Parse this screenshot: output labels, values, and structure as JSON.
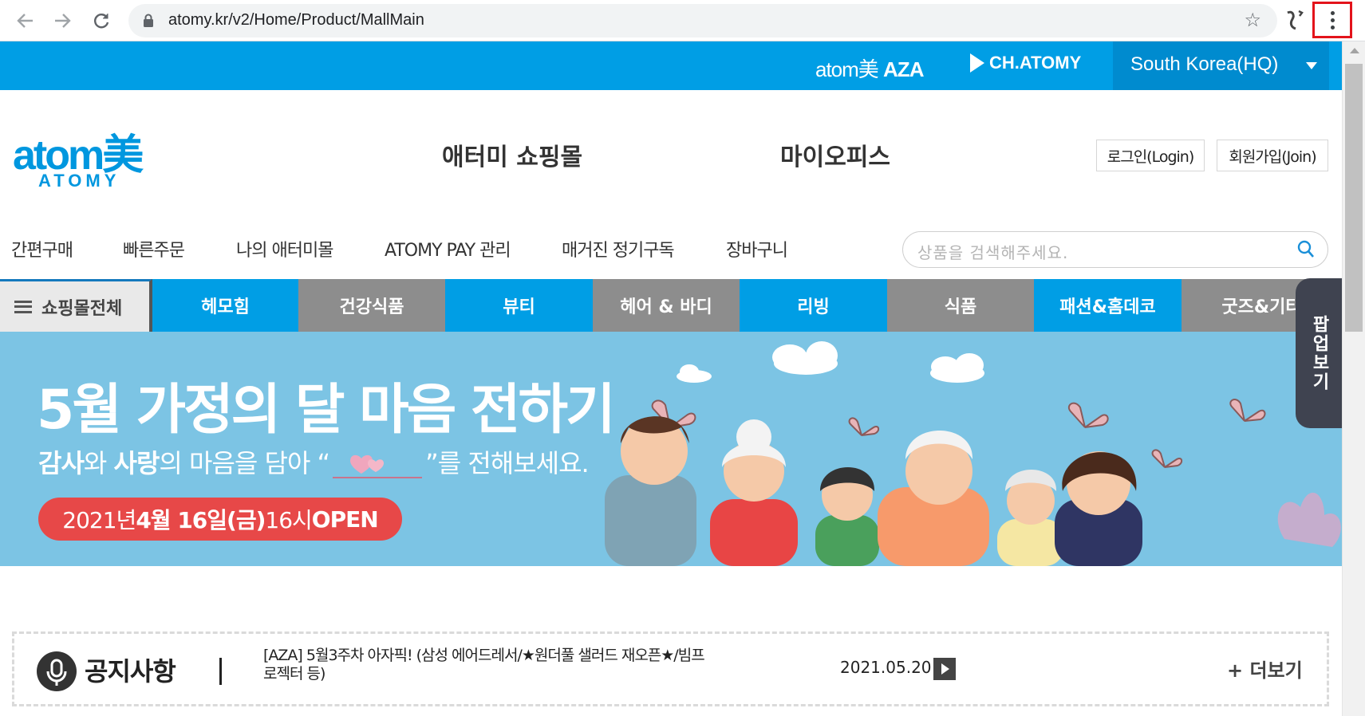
{
  "browser": {
    "url": "atomy.kr/v2/Home/Product/MallMain",
    "back_icon": "arrow-left-icon",
    "forward_icon": "arrow-right-icon",
    "reload_icon": "reload-icon",
    "menu_icon": "kebab-menu-icon"
  },
  "topbar": {
    "aza_light": "atom美 ",
    "aza_bold": "AZA",
    "ch_atomy": "CH.ATOMY",
    "region": "South Korea(HQ)",
    "accent": "#009ee5"
  },
  "header": {
    "logo_word": "atom美",
    "logo_sub": "ATOMY",
    "shopping_mall": "애터미 쇼핑몰",
    "my_office": "마이오피스",
    "login": "로그인(Login)",
    "join": "회원가입(Join)"
  },
  "subnav": {
    "items": [
      "간편구매",
      "빠른주문",
      "나의 애터미몰",
      "ATOMY PAY 관리",
      "매거진 정기구독",
      "장바구니"
    ],
    "search_placeholder": "상품을 검색해주세요."
  },
  "categories": {
    "all": "쇼핑몰전체",
    "items": [
      "헤모힘",
      "건강식품",
      "뷰티",
      "헤어 & 바디",
      "리빙",
      "식품",
      "패션&홈데코",
      "굿즈&기타"
    ]
  },
  "popup_tab": "팝업보기",
  "banner": {
    "title": "5월 가정의 달 마음 전하기",
    "sub_b1": "감사",
    "sub_1": "와 ",
    "sub_b2": "사랑",
    "sub_2": "의 마음을 담아 “",
    "sub_3": "”를 전해보세요.",
    "open_1": "2021년 ",
    "open_b1": "4월 16일(금)",
    "open_2": " 16시 ",
    "open_b2": "OPEN"
  },
  "notice": {
    "title": "공지사항",
    "headline": "[AZA] 5월3주차 아자픽! (삼성 에어드레서/★원더풀 샐러드 재오픈★/빔프로젝터 등)",
    "date": "2021.05.20",
    "more": "+ 더보기"
  }
}
